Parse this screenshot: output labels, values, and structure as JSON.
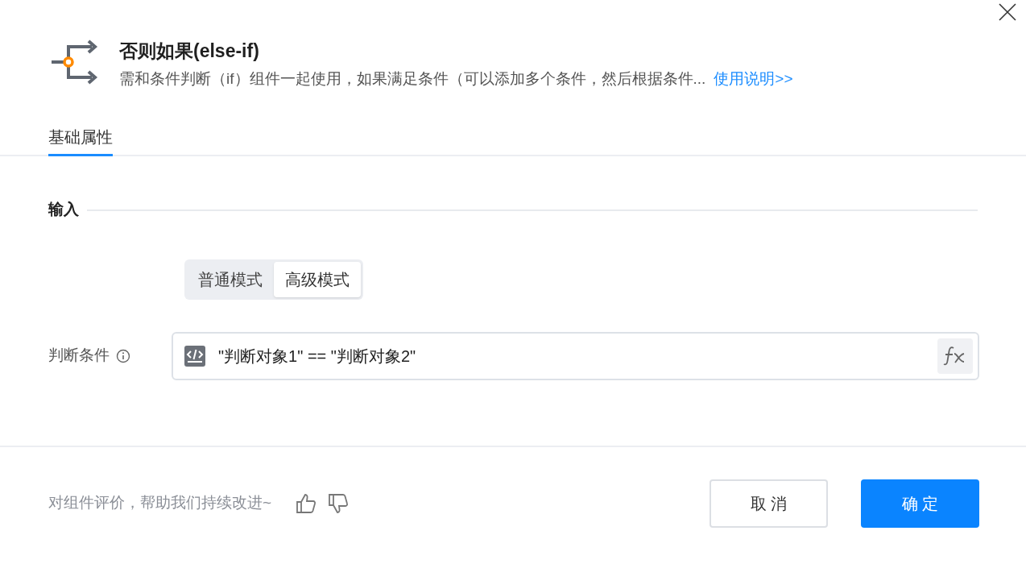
{
  "header": {
    "title": "否则如果(else-if)",
    "description": "需和条件判断（if）组件一起使用，如果满足条件（可以添加多个条件，然后根据条件...",
    "help_link": "使用说明>>"
  },
  "tabs": [
    {
      "label": "基础属性",
      "selected": true
    }
  ],
  "section": {
    "title": "输入"
  },
  "modes": [
    {
      "label": "普通模式",
      "selected": false
    },
    {
      "label": "高级模式",
      "selected": true
    }
  ],
  "condition": {
    "label": "判断条件",
    "value": "\"判断对象1\" == \"判断对象2\""
  },
  "footer": {
    "feedback": "对组件评价，帮助我们持续改进~",
    "buttons": [
      {
        "label": "取 消",
        "kind": "secondary"
      },
      {
        "label": "确 定",
        "kind": "primary"
      }
    ]
  }
}
